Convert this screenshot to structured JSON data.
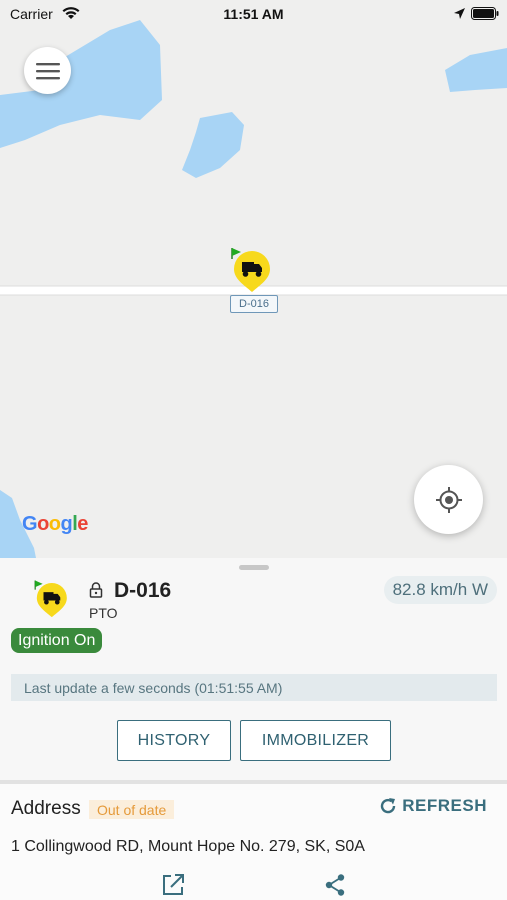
{
  "status_bar": {
    "carrier": "Carrier",
    "time": "11:51 AM"
  },
  "map": {
    "vehicle_label": "D-016",
    "attribution_letters": [
      "G",
      "o",
      "o",
      "g",
      "l",
      "e"
    ],
    "attribution_colors": [
      "#4285F4",
      "#EA4335",
      "#FBBC05",
      "#4285F4",
      "#34A853",
      "#EA4335"
    ],
    "colors": {
      "water": "#a8d4f5",
      "land": "#efefee",
      "road": "#ffffff",
      "marker": "#f7d91c"
    }
  },
  "vehicle": {
    "name": "D-016",
    "subtitle": "PTO",
    "speed": "82.8 km/h W",
    "ignition": "Ignition On",
    "last_update": "Last update a few seconds (01:51:55 AM)"
  },
  "actions": {
    "history": "HISTORY",
    "immobilizer": "IMMOBILIZER"
  },
  "address": {
    "label": "Address",
    "status": "Out of date",
    "refresh": "REFRESH",
    "text": "1 Collingwood RD, Mount Hope No. 279, SK, S0A"
  },
  "icons": [
    "wifi-icon",
    "location-arrow-icon",
    "battery-icon",
    "menu-icon",
    "vehicle-marker-icon",
    "my-location-icon",
    "lock-icon",
    "refresh-icon",
    "open-external-icon",
    "share-icon"
  ],
  "colors": {
    "accent": "#3a6e7e",
    "ignition": "#3a8a3c",
    "warning": "#e59a3a"
  }
}
